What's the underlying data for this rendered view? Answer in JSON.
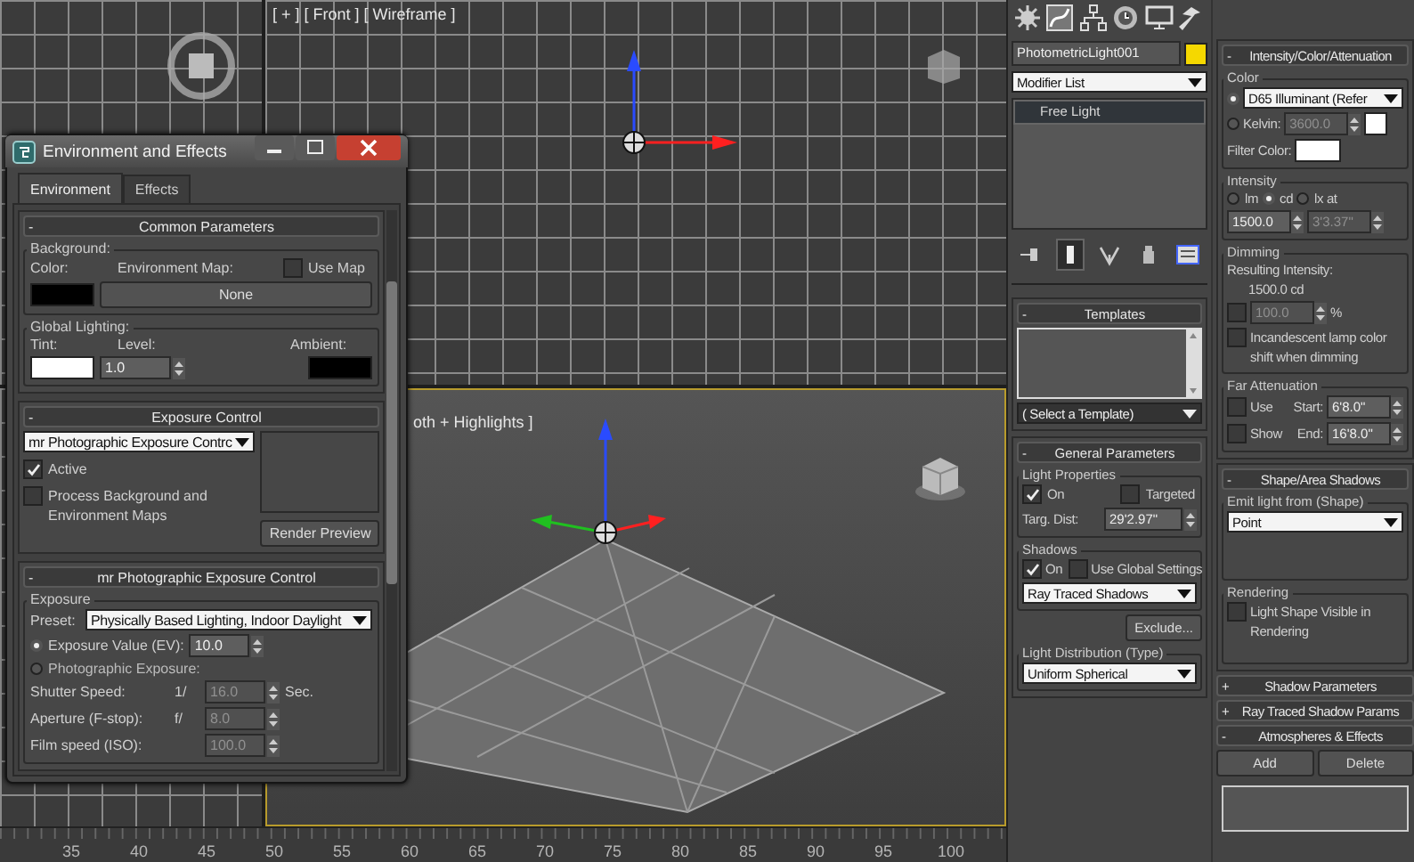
{
  "viewports": {
    "front_label": "[ + ] [ Front ] [ Wireframe ]",
    "perspective_label": "oth + Highlights ]"
  },
  "ruler": [
    "35",
    "40",
    "45",
    "50",
    "55",
    "60",
    "65",
    "70",
    "75",
    "80",
    "85",
    "90",
    "95",
    "100"
  ],
  "dialog": {
    "title": "Environment and Effects",
    "tabs": [
      {
        "label": "Environment",
        "selected": true
      },
      {
        "label": "Effects",
        "selected": false
      }
    ],
    "common": {
      "sign": "-",
      "title": "Common Parameters",
      "background_title": "Background:",
      "color_label": "Color:",
      "env_map_label": "Environment Map:",
      "use_map": {
        "label": "Use Map",
        "checked": false
      },
      "map_button": "None",
      "global_title": "Global Lighting:",
      "tint_label": "Tint:",
      "level_label": "Level:",
      "level": {
        "value": "1.0",
        "disabled": false
      },
      "ambient_label": "Ambient:"
    },
    "exposure": {
      "sign": "-",
      "title": "Exposure Control",
      "type": "mr Photographic Exposure Contrc",
      "active": {
        "label": "Active",
        "checked": true
      },
      "process": {
        "label": "Process Background and Environment Maps",
        "checked": false
      },
      "preview_button": "Render Preview"
    },
    "mr": {
      "sign": "-",
      "title": "mr Photographic Exposure Control",
      "group_title": "Exposure",
      "preset_label": "Preset:",
      "preset": "Physically Based Lighting, Indoor Daylight",
      "modes": [
        {
          "label": "Exposure Value (EV):",
          "selected": true
        },
        {
          "label": "Photographic Exposure:",
          "selected": false
        }
      ],
      "ev": {
        "value": "10.0",
        "disabled": false
      },
      "params": [
        {
          "label": "Shutter Speed:",
          "prefix": "1/",
          "value": "16.0",
          "disabled": true,
          "unit": "Sec."
        },
        {
          "label": "Aperture (F-stop):",
          "prefix": "f/",
          "value": "8.0",
          "disabled": true
        },
        {
          "label": "Film speed (ISO):",
          "value": "100.0",
          "disabled": true
        }
      ]
    }
  },
  "command_panel": {
    "tabs": [
      {
        "kind": "create"
      },
      {
        "kind": "modify"
      },
      {
        "kind": "hierarchy"
      },
      {
        "kind": "motion"
      },
      {
        "kind": "display"
      },
      {
        "kind": "utilities"
      }
    ],
    "object_name": "PhotometricLight001",
    "modifier_list": "Modifier List",
    "stack": [
      {
        "label": "Free Light",
        "selected": true
      }
    ],
    "stack_tools": [
      {
        "kind": "pin",
        "selected": false
      },
      {
        "kind": "end_result",
        "selected": true
      },
      {
        "kind": "unique",
        "selected": false
      },
      {
        "kind": "remove",
        "selected": false
      },
      {
        "kind": "configure",
        "selected": false
      }
    ],
    "templates": {
      "sign": "-",
      "title": "Templates",
      "select": "( Select a Template)"
    },
    "general": {
      "sign": "-",
      "title": "General Parameters",
      "light_title": "Light Properties",
      "on": {
        "label": "On",
        "checked": true
      },
      "targeted": {
        "label": "Targeted",
        "checked": false
      },
      "dist_label": "Targ. Dist:",
      "dist": {
        "value": "29'2.97\"",
        "disabled": false
      },
      "shadows_title": "Shadows",
      "shadows_on": {
        "label": "On",
        "checked": true
      },
      "global": {
        "label": "Use Global Settings",
        "checked": false
      },
      "shadow_type": "Ray Traced Shadows",
      "exclude": "Exclude...",
      "dist_title": "Light Distribution (Type)",
      "distribution": "Uniform Spherical"
    },
    "intensity": {
      "sign": "-",
      "title": "Intensity/Color/Attenuation",
      "color_title": "Color",
      "preset_selected": true,
      "preset": "D65 Illuminant (Refer",
      "kelvin": {
        "label": "Kelvin:",
        "selected": false
      },
      "kelvin_value": {
        "value": "3600.0",
        "disabled": true
      },
      "filter_label": "Filter Color:",
      "intensity_title": "Intensity",
      "units": [
        {
          "label": "lm",
          "selected": false
        },
        {
          "label": "cd",
          "selected": true
        },
        {
          "label": "lx at",
          "selected": false
        }
      ],
      "value": {
        "value": "1500.0",
        "disabled": false
      },
      "distance": {
        "value": "3'3.37\"",
        "disabled": true
      },
      "dimming_title": "Dimming",
      "resulting_label": "Resulting Intensity:",
      "resulting": "1500.0 cd",
      "percent_check": {
        "checked": false
      },
      "percent": {
        "value": "100.0",
        "disabled": true
      },
      "percent_unit": "%",
      "incandescent": {
        "label": "Incandescent lamp color shift when dimming",
        "checked": false
      },
      "far_title": "Far Attenuation",
      "use": {
        "label": "Use",
        "checked": false
      },
      "start_label": "Start:",
      "start": {
        "value": "6'8.0\"",
        "disabled": false
      },
      "show": {
        "label": "Show",
        "checked": false
      },
      "end_label": "End:",
      "end": {
        "value": "16'8.0\"",
        "disabled": false
      }
    },
    "shape": {
      "sign": "-",
      "title": "Shape/Area Shadows",
      "emit_title": "Emit light from (Shape)",
      "emit": "Point",
      "render_title": "Rendering",
      "visible": {
        "label": "Light Shape Visible in Rendering",
        "checked": false
      }
    },
    "collapsed": [
      {
        "sign": "+",
        "title": "Shadow Parameters"
      },
      {
        "sign": "+",
        "title": "Ray Traced Shadow Params"
      }
    ],
    "atmos": {
      "sign": "-",
      "title": "Atmospheres & Effects",
      "add": "Add",
      "delete": "Delete"
    }
  }
}
